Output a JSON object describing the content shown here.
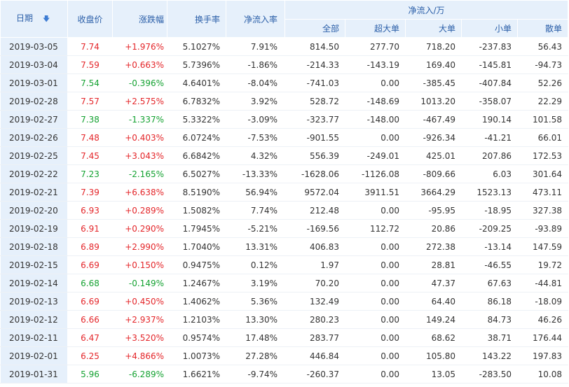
{
  "header": {
    "date": "日期",
    "close": "收盘价",
    "change": "涨跌幅",
    "turnover": "换手率",
    "net_rate": "净流入率",
    "net_flow": "净流入/万",
    "all": "全部",
    "super_large": "超大单",
    "large": "大单",
    "small": "小单",
    "retail": "散单"
  },
  "colors": {
    "up": "#e4262a",
    "down": "#15a232",
    "header_bg": "#e6f0fb",
    "header_text": "#2a5ea8"
  },
  "icons": {
    "sort": "sort-down-arrow-icon"
  },
  "rows": [
    {
      "date": "2019-03-05",
      "close": "7.74",
      "change": "+1.976%",
      "turnover": "5.1027%",
      "net_rate": "7.91%",
      "all": "814.50",
      "super_large": "277.70",
      "large": "718.20",
      "small": "-237.83",
      "retail": "56.43",
      "dir": "up"
    },
    {
      "date": "2019-03-04",
      "close": "7.59",
      "change": "+0.663%",
      "turnover": "5.7396%",
      "net_rate": "-1.86%",
      "all": "-214.33",
      "super_large": "-143.19",
      "large": "169.40",
      "small": "-145.81",
      "retail": "-94.73",
      "dir": "up"
    },
    {
      "date": "2019-03-01",
      "close": "7.54",
      "change": "-0.396%",
      "turnover": "4.6401%",
      "net_rate": "-8.04%",
      "all": "-741.03",
      "super_large": "0.00",
      "large": "-385.45",
      "small": "-407.84",
      "retail": "52.26",
      "dir": "down"
    },
    {
      "date": "2019-02-28",
      "close": "7.57",
      "change": "+2.575%",
      "turnover": "6.7832%",
      "net_rate": "3.92%",
      "all": "528.72",
      "super_large": "-148.69",
      "large": "1013.20",
      "small": "-358.07",
      "retail": "22.29",
      "dir": "up"
    },
    {
      "date": "2019-02-27",
      "close": "7.38",
      "change": "-1.337%",
      "turnover": "5.3322%",
      "net_rate": "-3.09%",
      "all": "-323.77",
      "super_large": "-148.00",
      "large": "-467.49",
      "small": "190.14",
      "retail": "101.58",
      "dir": "down"
    },
    {
      "date": "2019-02-26",
      "close": "7.48",
      "change": "+0.403%",
      "turnover": "6.0724%",
      "net_rate": "-7.53%",
      "all": "-901.55",
      "super_large": "0.00",
      "large": "-926.34",
      "small": "-41.21",
      "retail": "66.01",
      "dir": "up"
    },
    {
      "date": "2019-02-25",
      "close": "7.45",
      "change": "+3.043%",
      "turnover": "6.6842%",
      "net_rate": "4.32%",
      "all": "556.39",
      "super_large": "-249.01",
      "large": "425.01",
      "small": "207.86",
      "retail": "172.53",
      "dir": "up"
    },
    {
      "date": "2019-02-22",
      "close": "7.23",
      "change": "-2.165%",
      "turnover": "6.5027%",
      "net_rate": "-13.33%",
      "all": "-1628.06",
      "super_large": "-1126.08",
      "large": "-809.66",
      "small": "6.03",
      "retail": "301.64",
      "dir": "down"
    },
    {
      "date": "2019-02-21",
      "close": "7.39",
      "change": "+6.638%",
      "turnover": "8.5190%",
      "net_rate": "56.94%",
      "all": "9572.04",
      "super_large": "3911.51",
      "large": "3664.29",
      "small": "1523.13",
      "retail": "473.11",
      "dir": "up"
    },
    {
      "date": "2019-02-20",
      "close": "6.93",
      "change": "+0.289%",
      "turnover": "1.5082%",
      "net_rate": "7.74%",
      "all": "212.48",
      "super_large": "0.00",
      "large": "-95.95",
      "small": "-18.95",
      "retail": "327.38",
      "dir": "up"
    },
    {
      "date": "2019-02-19",
      "close": "6.91",
      "change": "+0.290%",
      "turnover": "1.7945%",
      "net_rate": "-5.21%",
      "all": "-169.56",
      "super_large": "112.72",
      "large": "20.86",
      "small": "-209.25",
      "retail": "-93.89",
      "dir": "up"
    },
    {
      "date": "2019-02-18",
      "close": "6.89",
      "change": "+2.990%",
      "turnover": "1.7040%",
      "net_rate": "13.31%",
      "all": "406.83",
      "super_large": "0.00",
      "large": "272.38",
      "small": "-13.14",
      "retail": "147.59",
      "dir": "up"
    },
    {
      "date": "2019-02-15",
      "close": "6.69",
      "change": "+0.150%",
      "turnover": "0.9475%",
      "net_rate": "0.12%",
      "all": "1.97",
      "super_large": "0.00",
      "large": "28.81",
      "small": "-46.55",
      "retail": "19.72",
      "dir": "up"
    },
    {
      "date": "2019-02-14",
      "close": "6.68",
      "change": "-0.149%",
      "turnover": "1.2467%",
      "net_rate": "3.19%",
      "all": "70.20",
      "super_large": "0.00",
      "large": "47.37",
      "small": "67.63",
      "retail": "-44.81",
      "dir": "down"
    },
    {
      "date": "2019-02-13",
      "close": "6.69",
      "change": "+0.450%",
      "turnover": "1.4062%",
      "net_rate": "5.36%",
      "all": "132.49",
      "super_large": "0.00",
      "large": "64.40",
      "small": "86.18",
      "retail": "-18.09",
      "dir": "up"
    },
    {
      "date": "2019-02-12",
      "close": "6.66",
      "change": "+2.937%",
      "turnover": "1.2103%",
      "net_rate": "13.30%",
      "all": "280.23",
      "super_large": "0.00",
      "large": "149.24",
      "small": "84.73",
      "retail": "46.26",
      "dir": "up"
    },
    {
      "date": "2019-02-11",
      "close": "6.47",
      "change": "+3.520%",
      "turnover": "0.9574%",
      "net_rate": "17.48%",
      "all": "283.77",
      "super_large": "0.00",
      "large": "68.62",
      "small": "38.71",
      "retail": "176.44",
      "dir": "up"
    },
    {
      "date": "2019-02-01",
      "close": "6.25",
      "change": "+4.866%",
      "turnover": "1.0073%",
      "net_rate": "27.28%",
      "all": "446.84",
      "super_large": "0.00",
      "large": "105.80",
      "small": "143.22",
      "retail": "197.83",
      "dir": "up"
    },
    {
      "date": "2019-01-31",
      "close": "5.96",
      "change": "-6.289%",
      "turnover": "1.6621%",
      "net_rate": "-9.74%",
      "all": "-260.37",
      "super_large": "0.00",
      "large": "13.05",
      "small": "-283.50",
      "retail": "10.08",
      "dir": "down"
    }
  ]
}
